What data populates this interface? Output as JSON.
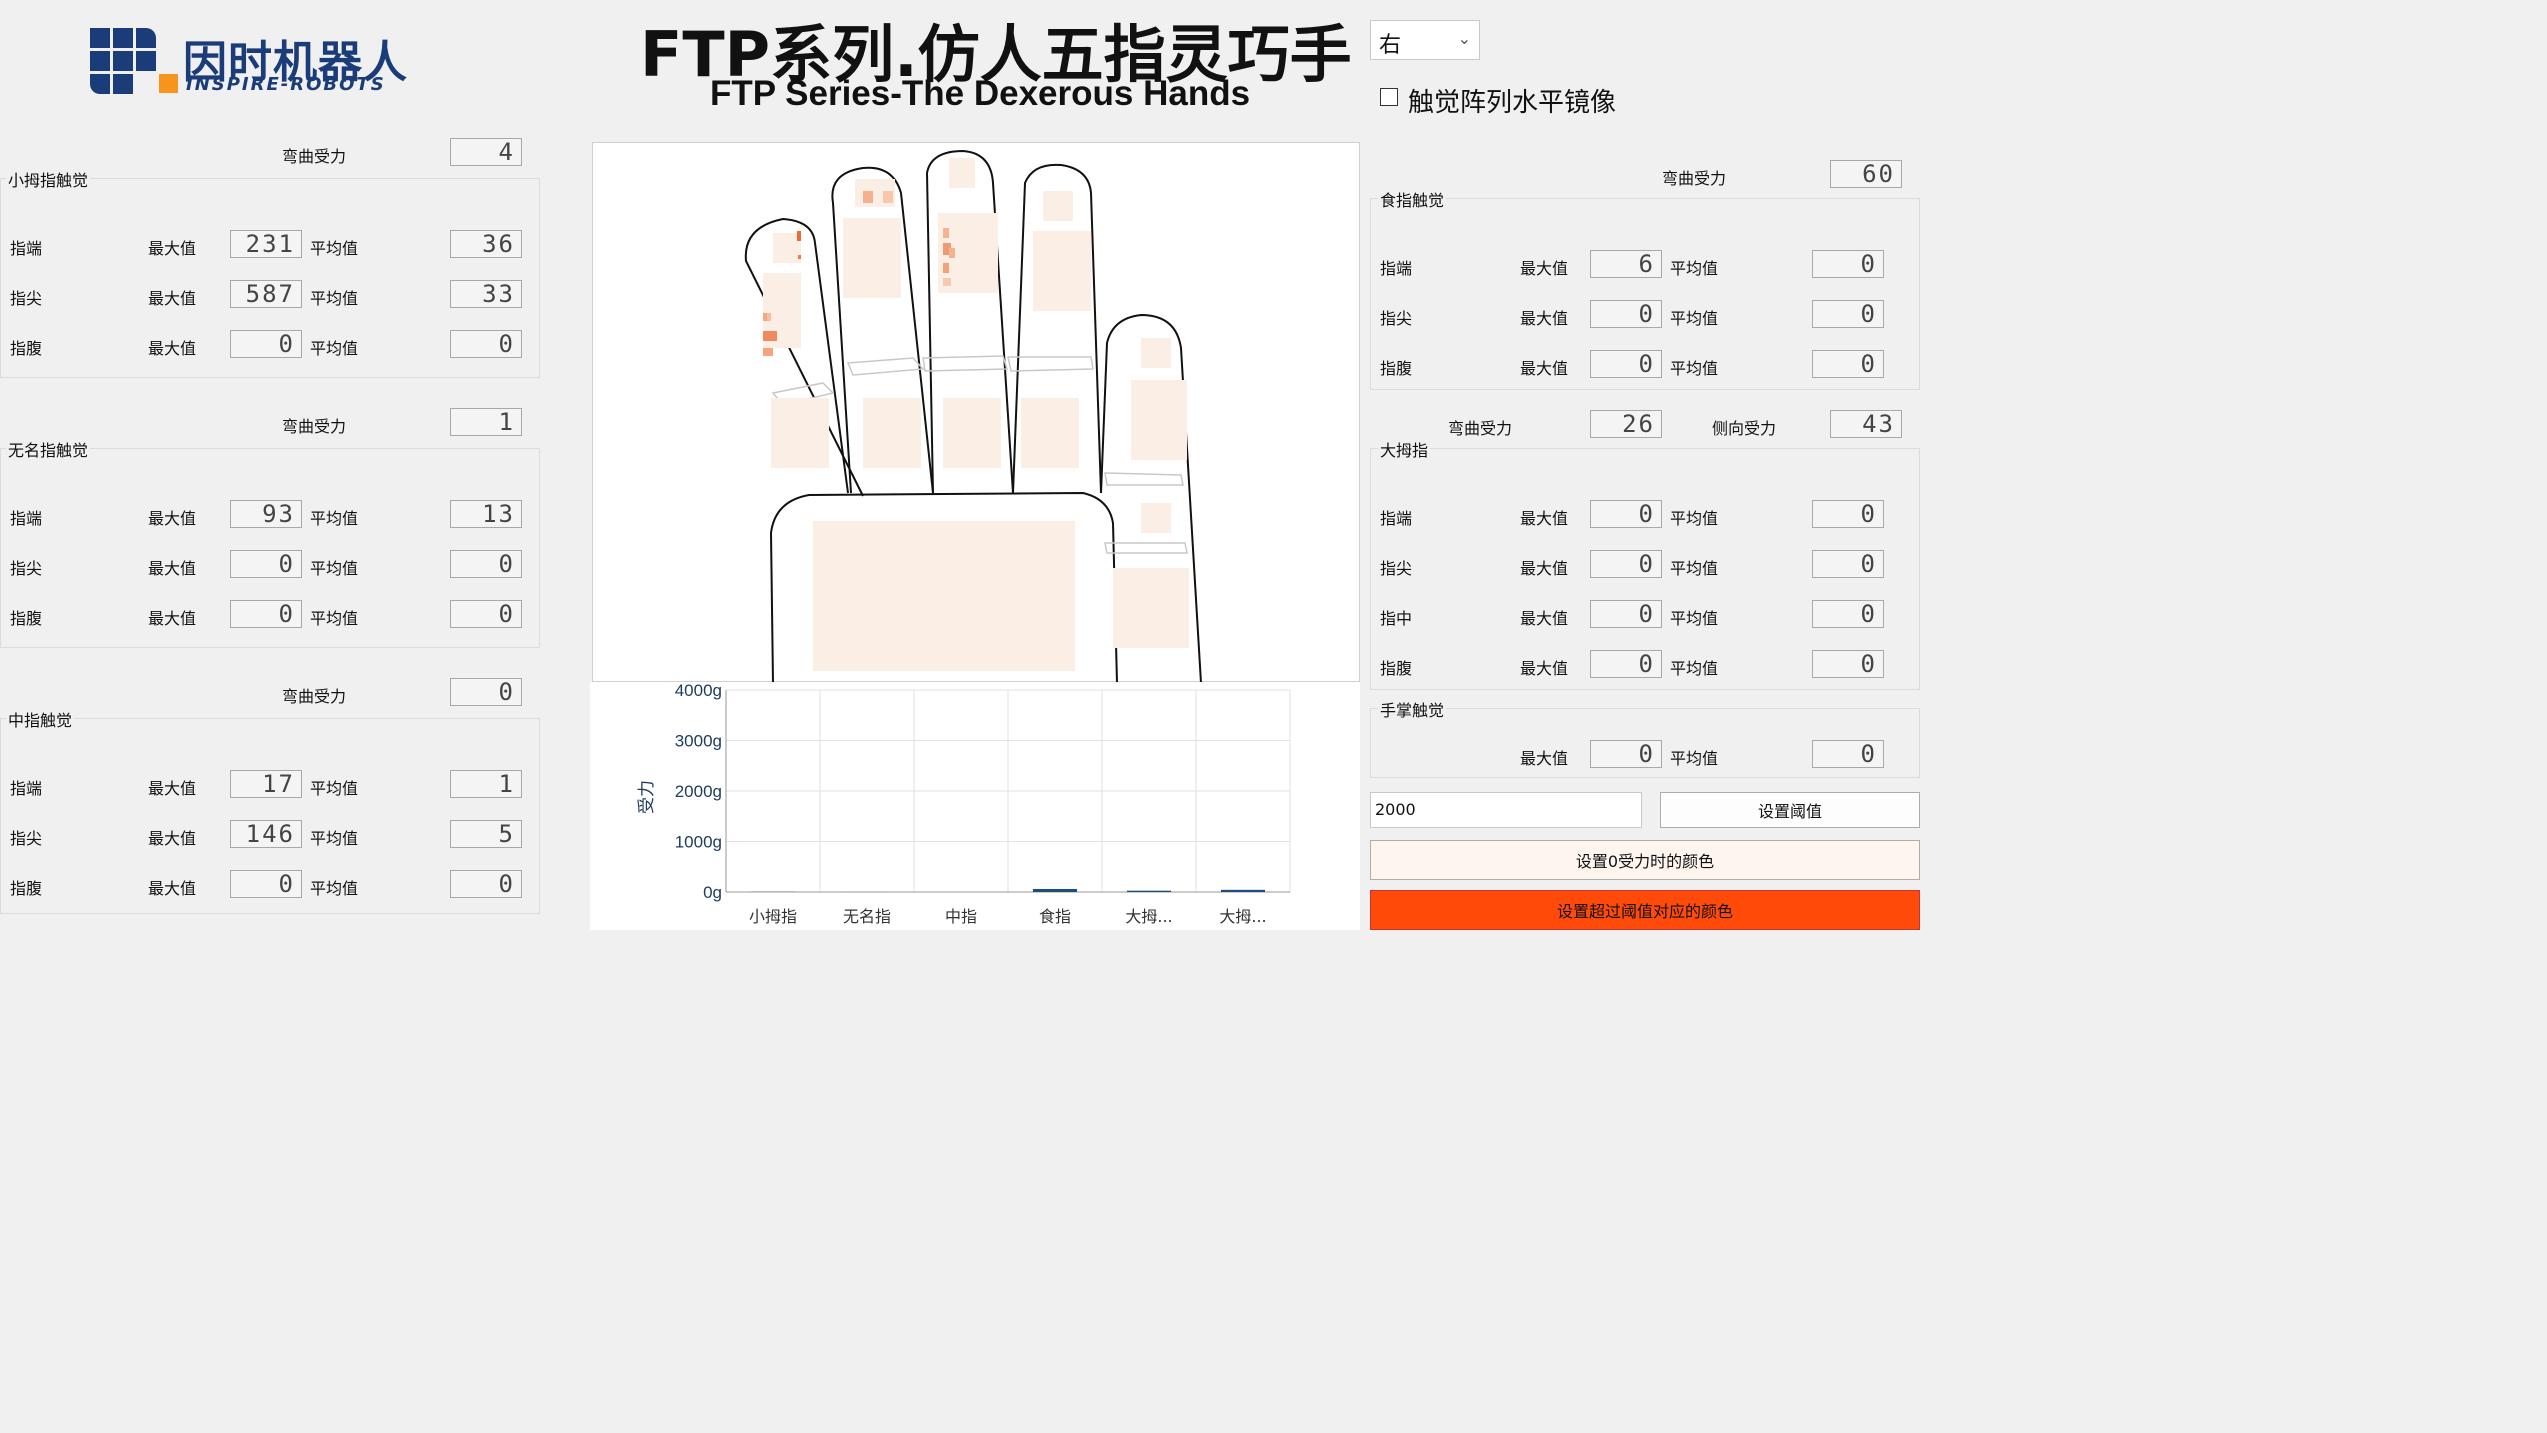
{
  "header": {
    "logo_cn": "因时机器人",
    "logo_en": "INSPIRE-ROBOTS",
    "title_cn": "FTP系列.仿人五指灵巧手",
    "title_en": "FTP Series-The Dexerous Hands"
  },
  "controls": {
    "hand_select": "右",
    "mirror_label": "触觉阵列水平镜像",
    "threshold_value": "2000",
    "set_threshold_btn": "设置阈值",
    "zero_color_btn": "设置0受力时的颜色",
    "over_color_btn": "设置超过阈值对应的颜色",
    "zero_color": "#fdf5ee",
    "over_color": "#ff4a0a"
  },
  "labels": {
    "bend_force": "弯曲受力",
    "side_force": "侧向受力",
    "max": "最大值",
    "avg": "平均值"
  },
  "left_groups": [
    {
      "title": "小拇指触觉",
      "bend": "4",
      "rows": [
        {
          "name": "指端",
          "max": "231",
          "avg": "36"
        },
        {
          "name": "指尖",
          "max": "587",
          "avg": "33"
        },
        {
          "name": "指腹",
          "max": "0",
          "avg": "0"
        }
      ]
    },
    {
      "title": "无名指触觉",
      "bend": "1",
      "rows": [
        {
          "name": "指端",
          "max": "93",
          "avg": "13"
        },
        {
          "name": "指尖",
          "max": "0",
          "avg": "0"
        },
        {
          "name": "指腹",
          "max": "0",
          "avg": "0"
        }
      ]
    },
    {
      "title": "中指触觉",
      "bend": "0",
      "rows": [
        {
          "name": "指端",
          "max": "17",
          "avg": "1"
        },
        {
          "name": "指尖",
          "max": "146",
          "avg": "5"
        },
        {
          "name": "指腹",
          "max": "0",
          "avg": "0"
        }
      ]
    }
  ],
  "index_group": {
    "title": "食指触觉",
    "bend": "60",
    "rows": [
      {
        "name": "指端",
        "max": "6",
        "avg": "0"
      },
      {
        "name": "指尖",
        "max": "0",
        "avg": "0"
      },
      {
        "name": "指腹",
        "max": "0",
        "avg": "0"
      }
    ]
  },
  "thumb_group": {
    "title": "大拇指",
    "bend": "26",
    "side": "43",
    "rows": [
      {
        "name": "指端",
        "max": "0",
        "avg": "0"
      },
      {
        "name": "指尖",
        "max": "0",
        "avg": "0"
      },
      {
        "name": "指中",
        "max": "0",
        "avg": "0"
      },
      {
        "name": "指腹",
        "max": "0",
        "avg": "0"
      }
    ]
  },
  "palm_group": {
    "title": "手掌触觉",
    "max": "0",
    "avg": "0"
  },
  "chart_data": {
    "type": "bar",
    "ylabel": "受力",
    "categories": [
      "小拇指",
      "无名指",
      "中指",
      "食指",
      "大拇...",
      "大拇..."
    ],
    "values": [
      4,
      1,
      0,
      60,
      26,
      43
    ],
    "yticks": [
      "4000g",
      "3000g",
      "2000g",
      "1000g",
      "0g"
    ],
    "ylim": [
      0,
      4000
    ],
    "bar_color": "#1f4e79",
    "grid": true
  }
}
